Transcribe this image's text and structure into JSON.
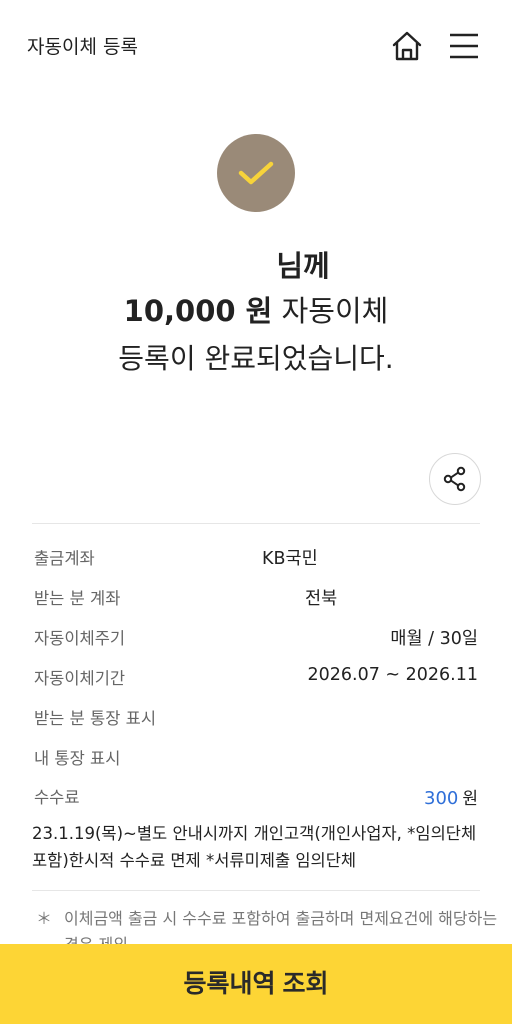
{
  "header": {
    "title": "자동이체 등록",
    "icons": [
      "home-icon",
      "menu-icon"
    ]
  },
  "result": {
    "recipient_suffix": "님께",
    "amount": "10,000 원",
    "amount_suffix": "자동이체",
    "complete_text": "등록이 완료되었습니다.",
    "status_icon": "check-icon"
  },
  "share": {
    "icon": "share-icon"
  },
  "details": {
    "withdraw_label": "출금계좌",
    "withdraw_value": "KB국민",
    "receive_label": "받는 분 계좌",
    "receive_value": "전북",
    "cycle_label": "자동이체주기",
    "cycle_value": "매월 / 30일",
    "period_label": "자동이체기간",
    "period_value": "2026.07 ~ 2026.11",
    "receiver_memo_label": "받는 분 통장 표시",
    "my_memo_label": "내 통장 표시",
    "fee_label": "수수료",
    "fee_value": "300",
    "fee_unit": "원"
  },
  "notice": {
    "line1": "23.1.19(목)~별도 안내시까지 개인고객(개인사업자, *임의단체",
    "line2": "포함)한시적 수수료 면제    *서류미제출 임의단체"
  },
  "footnote": {
    "star": "＊",
    "text": "이체금액 출금 시 수수료 포함하여 출금하며 면제요건에 해당하는 경우 제외"
  },
  "bottom_button": {
    "label": "등록내역 조회"
  },
  "colors": {
    "accent_yellow": "#fdd535",
    "check_circle": "#9a8a78",
    "check_mark": "#f7d33a",
    "fee_blue": "#2f6fd8"
  }
}
